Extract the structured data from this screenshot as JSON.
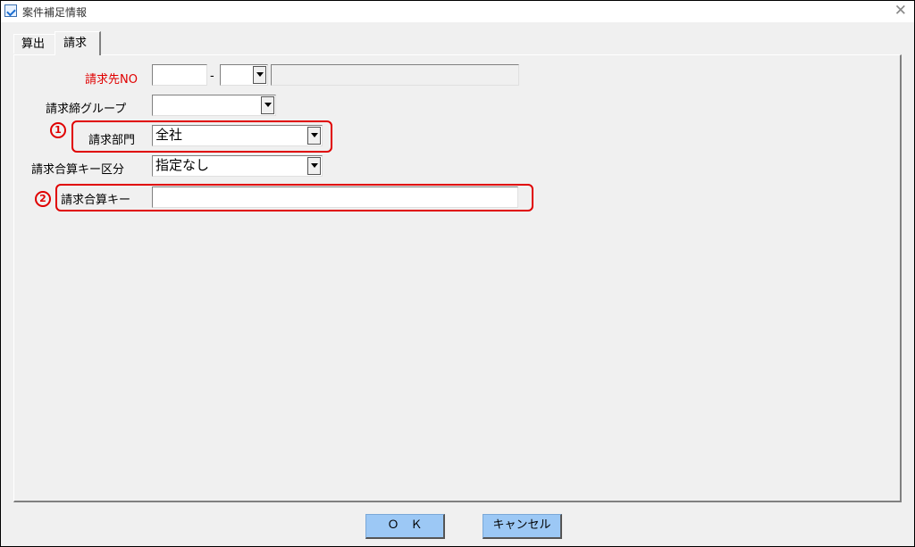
{
  "window": {
    "title": "案件補足情報",
    "close_glyph": "✕"
  },
  "tabs": [
    {
      "label": "算出"
    },
    {
      "label": "請求"
    }
  ],
  "form": {
    "billing_no": {
      "label": "請求先NO",
      "part1": "",
      "separator": "-",
      "part2": "",
      "name_value": ""
    },
    "closing_group": {
      "label": "請求締グループ",
      "value": ""
    },
    "billing_dept": {
      "label": "請求部門",
      "value": "全社",
      "marker": "1"
    },
    "summary_key_type": {
      "label": "請求合算キー区分",
      "value": "指定なし"
    },
    "summary_key": {
      "label": "請求合算キー",
      "value": "",
      "marker": "2"
    }
  },
  "buttons": {
    "ok": "Ｏ　Ｋ",
    "cancel": "キャンセル"
  },
  "colors": {
    "highlight": "#e00000",
    "required_label": "#e00000",
    "button": "#9cc8f5"
  }
}
